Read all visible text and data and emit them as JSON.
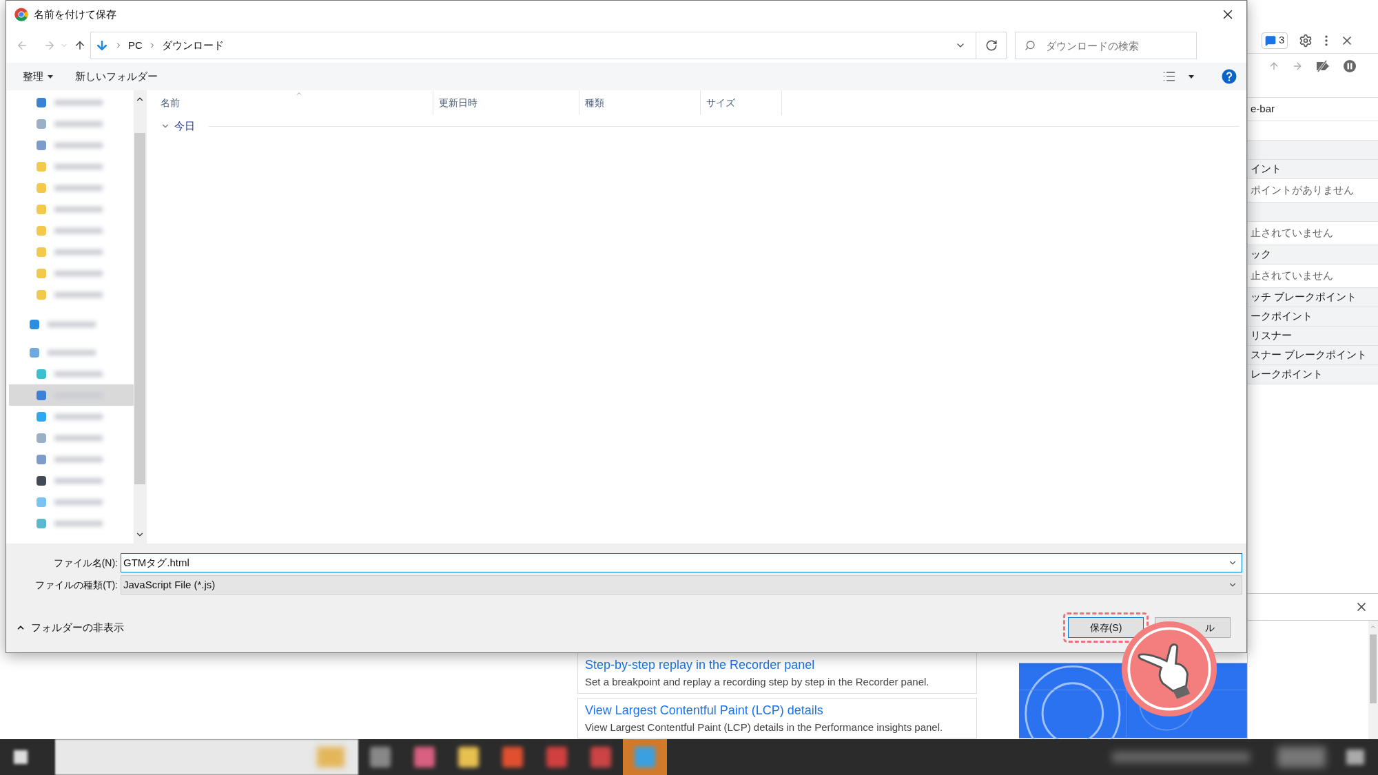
{
  "dialog": {
    "title": "名前を付けて保存",
    "path": [
      "PC",
      "ダウンロード"
    ],
    "search": {
      "placeholder": "ダウンロードの検索"
    },
    "toolbar": {
      "organize": "整理",
      "new_folder": "新しいフォルダー"
    },
    "columns": [
      "名前",
      "更新日時",
      "種類",
      "サイズ"
    ],
    "groups": [
      {
        "label": "今日",
        "expanded": true
      }
    ],
    "sidebar": {
      "items": [
        {
          "kind": "child",
          "color": "#3b82d6",
          "selected": false
        },
        {
          "kind": "child",
          "color": "#9ab0c4",
          "selected": false
        },
        {
          "kind": "child",
          "color": "#7d9cc9",
          "selected": false
        },
        {
          "kind": "child",
          "color": "#f2c94c",
          "selected": false
        },
        {
          "kind": "child",
          "color": "#f2c94c",
          "selected": false
        },
        {
          "kind": "child",
          "color": "#f2c94c",
          "selected": false
        },
        {
          "kind": "child",
          "color": "#f2c94c",
          "selected": false
        },
        {
          "kind": "child",
          "color": "#f2c94c",
          "selected": false
        },
        {
          "kind": "child",
          "color": "#f2c94c",
          "selected": false
        },
        {
          "kind": "child",
          "color": "#f2c94c",
          "selected": false
        },
        {
          "kind": "root",
          "color": "#2d8ee0",
          "selected": false
        },
        {
          "kind": "root",
          "color": "#6fa8dc",
          "selected": false
        },
        {
          "kind": "child",
          "color": "#3cc0d0",
          "selected": false
        },
        {
          "kind": "child",
          "color": "#3b82d6",
          "selected": true
        },
        {
          "kind": "child",
          "color": "#2fa8f0",
          "selected": false
        },
        {
          "kind": "child",
          "color": "#9ab0c4",
          "selected": false
        },
        {
          "kind": "child",
          "color": "#7d9cc9",
          "selected": false
        },
        {
          "kind": "child",
          "color": "#444a55",
          "selected": false
        },
        {
          "kind": "child",
          "color": "#7cc4f0",
          "selected": false
        },
        {
          "kind": "child",
          "color": "#5bb8d0",
          "selected": false
        }
      ]
    },
    "filename": {
      "label": "ファイル名(N):",
      "value": "GTMタグ.html"
    },
    "filetype": {
      "label": "ファイルの種類(T):",
      "value": "JavaScript File (*.js)"
    },
    "hide_folders": "フォルダーの非表示",
    "buttons": [
      {
        "label": "保存(S)",
        "highlighted": true
      },
      {
        "label": "ル",
        "highlighted": false
      }
    ]
  },
  "devtools": {
    "badge": "3",
    "rows": [
      {
        "kind": "blank"
      },
      {
        "kind": "item",
        "text": "e-bar"
      },
      {
        "kind": "blank"
      },
      {
        "kind": "header"
      },
      {
        "kind": "header",
        "text": "イント"
      },
      {
        "kind": "item",
        "text": "ポイントがありません"
      },
      {
        "kind": "header"
      },
      {
        "kind": "item",
        "text": "止されていません"
      },
      {
        "kind": "header",
        "text": "ック"
      },
      {
        "kind": "item",
        "text": "止されていません"
      },
      {
        "kind": "header",
        "text": "ッチ ブレークポイント"
      },
      {
        "kind": "header",
        "text": "ークポイント"
      },
      {
        "kind": "header",
        "text": "リスナー"
      },
      {
        "kind": "header",
        "text": "スナー ブレークポイント"
      },
      {
        "kind": "header",
        "text": "レークポイント"
      }
    ]
  },
  "page": {
    "cards": [
      {
        "title": "Step-by-step replay in the Recorder panel",
        "text": "Set a breakpoint and replay a recording step by step in the Recorder panel."
      },
      {
        "title": "View Largest Contentful Paint (LCP) details",
        "text": "View Largest Contentful Paint (LCP) details in the Performance insights panel."
      }
    ]
  }
}
